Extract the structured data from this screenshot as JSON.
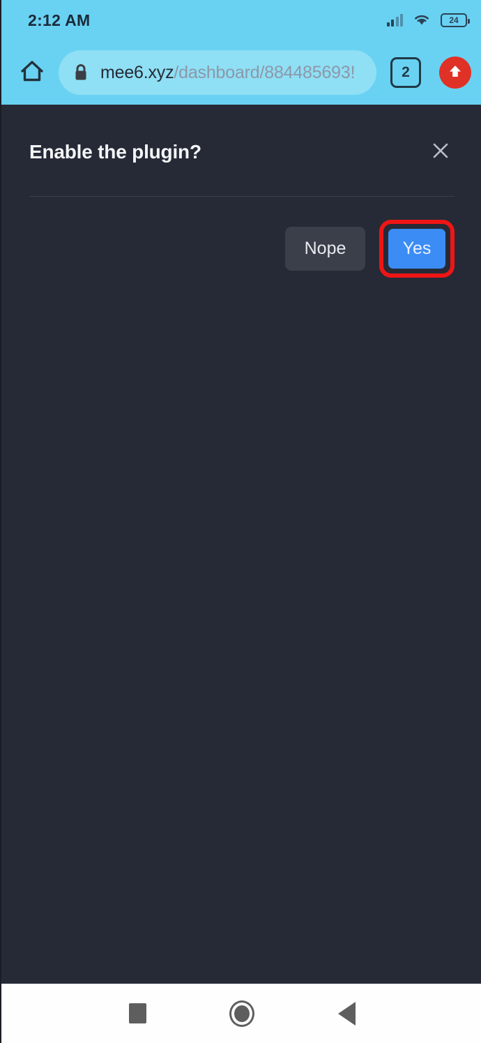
{
  "status_bar": {
    "time": "2:12 AM",
    "battery_level": "24",
    "signal_icon": "signal-bars-icon",
    "wifi_icon": "wifi-icon",
    "battery_icon": "battery-icon"
  },
  "browser_bar": {
    "home_icon": "home-icon",
    "lock_icon": "lock-icon",
    "url_domain": "mee6.xyz",
    "url_path": "/dashboard/884485693!",
    "url_full": "mee6.xyz/dashboard/884485693!",
    "tab_count": "2",
    "menu_icon": "up-arrow-icon"
  },
  "dialog": {
    "title": "Enable the plugin?",
    "close_icon": "close-icon",
    "buttons": {
      "decline_label": "Nope",
      "confirm_label": "Yes"
    }
  },
  "nav_bar": {
    "recents_icon": "square-recents-icon",
    "home_icon": "circle-home-icon",
    "back_icon": "triangle-back-icon"
  },
  "colors": {
    "browser_chrome": "#69d2f2",
    "url_pill": "#8fdff5",
    "page_background": "#262a36",
    "confirm_button": "#3b8cf5",
    "decline_button": "#3b3f4a",
    "annotation_highlight": "#ef1515",
    "menu_button": "#e03127",
    "nav_bar_background": "#fefefe"
  }
}
